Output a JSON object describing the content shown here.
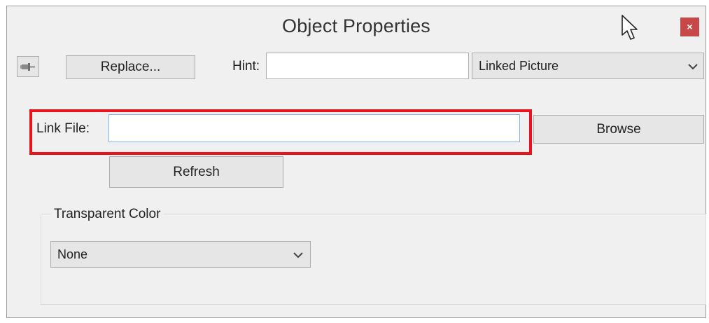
{
  "window": {
    "title": "Object Properties",
    "close_glyph": "×"
  },
  "toolbar": {
    "pin_icon": "pushpin-icon",
    "replace_label": "Replace...",
    "hint_label": "Hint:",
    "hint_value": "",
    "type_selected": "Linked Picture"
  },
  "link": {
    "label": "Link File:",
    "value": "",
    "browse_label": "Browse",
    "refresh_label": "Refresh"
  },
  "transparent": {
    "group_label": "Transparent Color",
    "selected": "None"
  },
  "colors": {
    "window_bg": "#f0f0f0",
    "close_bg": "#c74848",
    "highlight": "#e8141b",
    "focus_border": "#7eb4ea"
  }
}
